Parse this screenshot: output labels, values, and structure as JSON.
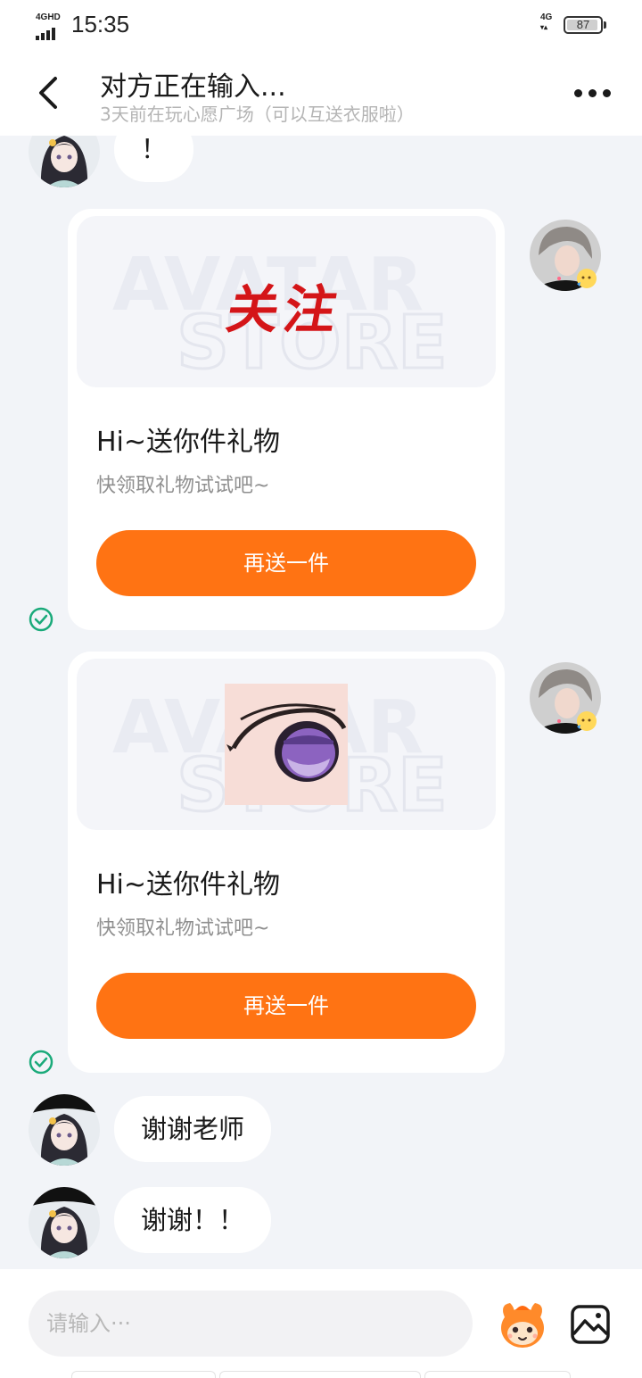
{
  "status_bar": {
    "network_left": "4GHD",
    "time": "15:35",
    "network_right": "4G",
    "battery": "87"
  },
  "header": {
    "title": "对方正在输入...",
    "subtitle": "3天前在玩心愿广场（可以互送衣服啦）"
  },
  "messages": {
    "top_partial": "！",
    "gift_1": {
      "image_text": "关注",
      "title": "Hi~送你件礼物",
      "desc": "快领取礼物试试吧~",
      "button": "再送一件"
    },
    "gift_2": {
      "title": "Hi~送你件礼物",
      "desc": "快领取礼物试试吧~",
      "button": "再送一件"
    },
    "reply_1": "谢谢老师",
    "reply_2": "谢谢！！"
  },
  "input": {
    "placeholder": "请输入···"
  },
  "colors": {
    "accent": "#ff7313",
    "read_check": "#1aaa7a",
    "background": "#f2f4f8"
  },
  "icons": {
    "back": "chevron-left-icon",
    "more": "more-dots-icon",
    "read": "check-circle-icon",
    "emoji": "mascot-emoji-icon",
    "image": "image-icon"
  }
}
